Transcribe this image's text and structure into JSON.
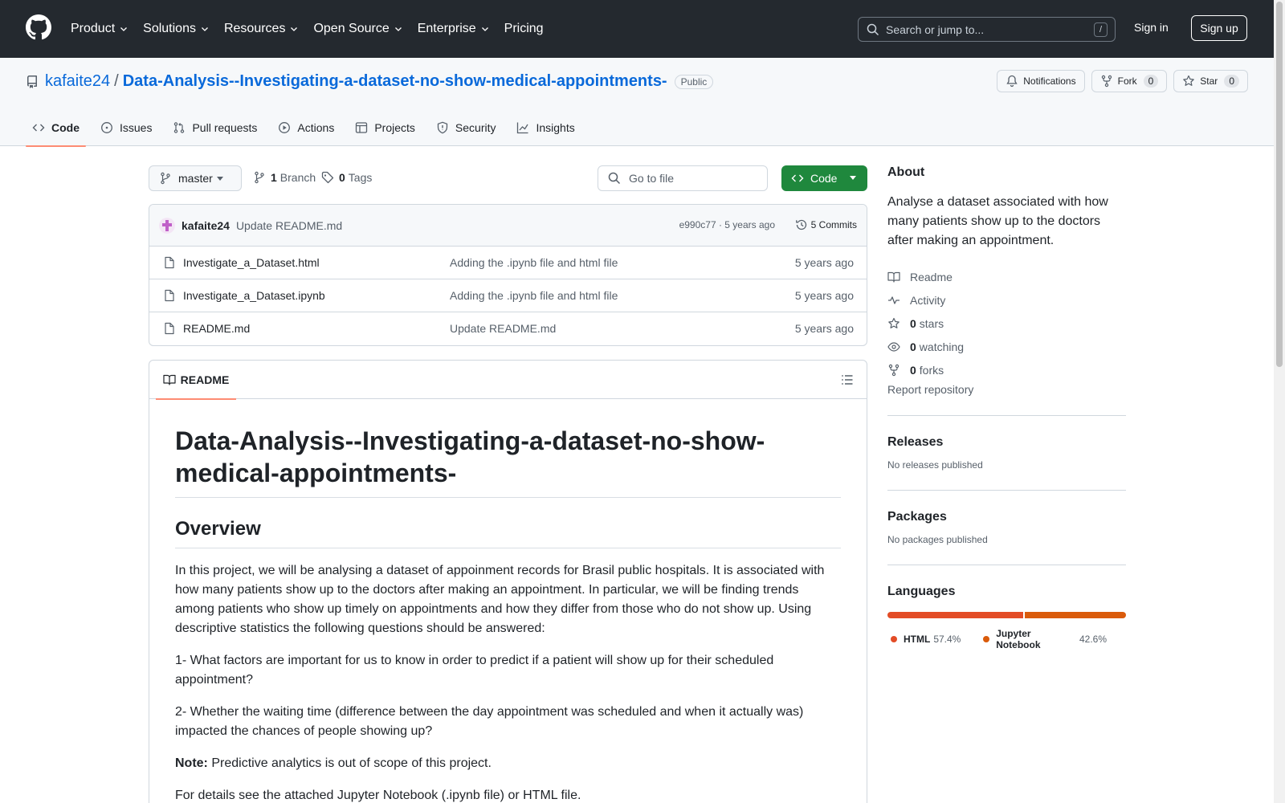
{
  "header": {
    "nav": [
      "Product",
      "Solutions",
      "Resources",
      "Open Source",
      "Enterprise",
      "Pricing"
    ],
    "search_placeholder": "Search or jump to...",
    "search_shortcut": "/",
    "sign_in": "Sign in",
    "sign_up": "Sign up"
  },
  "repo": {
    "owner": "kafaite24",
    "separator": "/",
    "name": "Data-Analysis--Investigating-a-dataset-no-show-medical-appointments-",
    "visibility": "Public",
    "notifications_label": "Notifications",
    "fork_label": "Fork",
    "fork_count": "0",
    "star_label": "Star",
    "star_count": "0"
  },
  "tabs": [
    "Code",
    "Issues",
    "Pull requests",
    "Actions",
    "Projects",
    "Security",
    "Insights"
  ],
  "toolbar": {
    "branch": "master",
    "branch_count": "1",
    "branch_label": "Branch",
    "tag_count": "0",
    "tag_label": "Tags",
    "go_to_file": "Go to file",
    "code_button": "Code"
  },
  "commit": {
    "author": "kafaite24",
    "message": "Update README.md",
    "meta": "e990c77 · 5 years ago",
    "commits_label": "5 Commits"
  },
  "files": [
    {
      "name": "Investigate_a_Dataset.html",
      "message": "Adding the .ipynb file and html file",
      "age": "5 years ago"
    },
    {
      "name": "Investigate_a_Dataset.ipynb",
      "message": "Adding the .ipynb file and html file",
      "age": "5 years ago"
    },
    {
      "name": "README.md",
      "message": "Update README.md",
      "age": "5 years ago"
    }
  ],
  "readme": {
    "tab_label": "README",
    "h1": "Data-Analysis--Investigating-a-dataset-no-show-medical-appointments-",
    "h2": "Overview",
    "p1": "In this project, we will be analysing a dataset of appoinment records for Brasil public hospitals. It is associated with how many patients show up to the doctors after making an appointment. In particular, we will be finding trends among patients who show up timely on appointments and how they differ from those who do not show up. Using descriptive statistics the following questions should be answered:",
    "p2": "1- What factors are important for us to know in order to predict if a patient will show up for their scheduled appointment?",
    "p3": "2- Whether the waiting time (difference between the day appointment was scheduled and when it actually was) impacted the chances of people showing up?",
    "note_label": "Note:",
    "note_text": " Predictive analytics is out of scope of this project.",
    "p5": "For details see the attached Jupyter Notebook (.ipynb file) or HTML file."
  },
  "sidebar": {
    "about_title": "About",
    "about_desc": "Analyse a dataset associated with how many patients show up to the doctors after making an appointment.",
    "readme": "Readme",
    "activity": "Activity",
    "stars_count": "0",
    "stars_label": "stars",
    "watching_count": "0",
    "watching_label": "watching",
    "forks_count": "0",
    "forks_label": "forks",
    "report": "Report repository",
    "releases_title": "Releases",
    "releases_text": "No releases published",
    "packages_title": "Packages",
    "packages_text": "No packages published",
    "languages_title": "Languages",
    "languages": [
      {
        "name": "HTML",
        "percent": "57.4%",
        "value": 57.4,
        "color": "#e34c26"
      },
      {
        "name": "Jupyter Notebook",
        "percent": "42.6%",
        "value": 42.6,
        "color": "#DA5B0B"
      }
    ]
  },
  "colors": {
    "header_bg": "#24292f",
    "link": "#0969da",
    "code_button": "#1f883d",
    "tab_underline": "#fd8c73"
  }
}
